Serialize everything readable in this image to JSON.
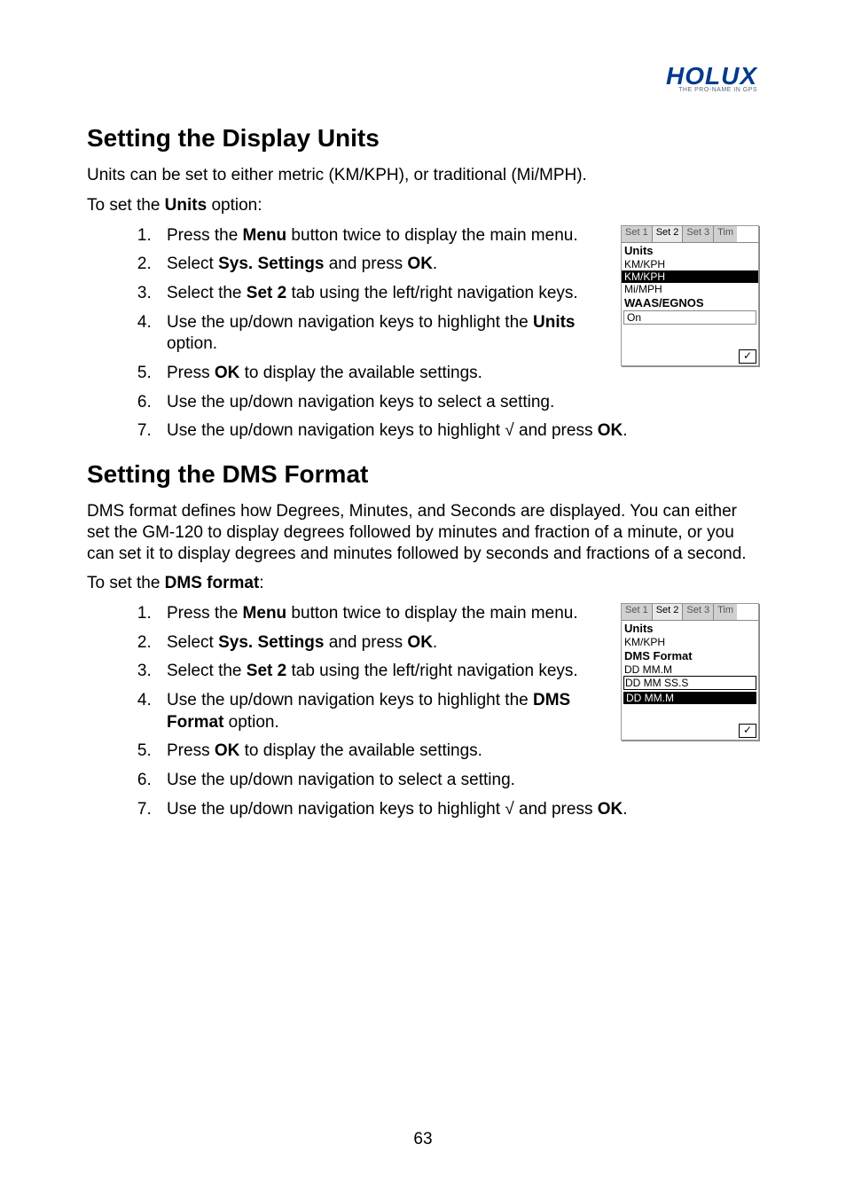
{
  "logo": {
    "brand": "HOLUX",
    "tagline": "THE PRO-NAME IN GPS"
  },
  "section1": {
    "heading": "Setting the Display Units",
    "intro": "Units can be set to either metric (KM/KPH), or traditional (Mi/MPH).",
    "lead": "To set the ",
    "lead_bold": "Units",
    "lead_tail": " option:",
    "steps": {
      "s1a": "Press the ",
      "s1b": "Menu",
      "s1c": " button twice to display the main menu.",
      "s2a": "Select ",
      "s2b": "Sys. Settings",
      "s2c": " and press ",
      "s2d": "OK",
      "s2e": ".",
      "s3a": "Select the ",
      "s3b": "Set 2",
      "s3c": " tab using the left/right navigation keys.",
      "s4a": "Use the up/down navigation keys to highlight the ",
      "s4b": "Units",
      "s4c": " option.",
      "s5a": "Press ",
      "s5b": "OK",
      "s5c": " to display the available settings.",
      "s6": "Use the up/down navigation keys to select a setting.",
      "s7a": "Use the up/down navigation keys to highlight √ and press ",
      "s7b": "OK",
      "s7c": "."
    }
  },
  "section2": {
    "heading": "Setting the DMS Format",
    "intro": "DMS format defines how Degrees, Minutes, and Seconds are displayed. You can either set the GM-120 to display degrees followed by minutes and fraction of a minute, or you can set it to display degrees and minutes followed by seconds and fractions of a second.",
    "lead": "To set the ",
    "lead_bold": "DMS format",
    "lead_tail": ":",
    "steps": {
      "s1a": "Press the ",
      "s1b": "Menu",
      "s1c": " button twice to display the main menu.",
      "s2a": "Select ",
      "s2b": "Sys. Settings",
      "s2c": " and press ",
      "s2d": "OK",
      "s2e": ".",
      "s3a": "Select the ",
      "s3b": "Set 2",
      "s3c": " tab using the left/right navigation keys.",
      "s4a": "Use the up/down navigation keys to highlight the ",
      "s4b": "DMS Format",
      "s4c": " option.",
      "s5a": "Press ",
      "s5b": "OK",
      "s5c": " to display the available settings.",
      "s6": "Use the up/down navigation to select a setting.",
      "s7a": "Use the up/down navigation keys to highlight √ and press ",
      "s7b": "OK",
      "s7c": "."
    }
  },
  "screen1": {
    "tabs": {
      "t1": "Set 1",
      "t2": "Set 2",
      "t3": "Set 3",
      "t4": "Tim"
    },
    "title1": "Units",
    "opt1": "KM/KPH",
    "opt2_sel": "KM/KPH",
    "opt3": "Mi/MPH",
    "title2": "WAAS/EGNOS",
    "opt4": "On",
    "ok": "✓"
  },
  "screen2": {
    "tabs": {
      "t1": "Set 1",
      "t2": "Set 2",
      "t3": "Set 3",
      "t4": "Tim"
    },
    "title1": "Units",
    "opt1": "KM/KPH",
    "title2": "DMS Format",
    "opt2": "DD MM.M",
    "opt3": "DD MM SS.S",
    "opt4_sel": "DD MM.M",
    "ok": "✓"
  },
  "pagenum": "63"
}
